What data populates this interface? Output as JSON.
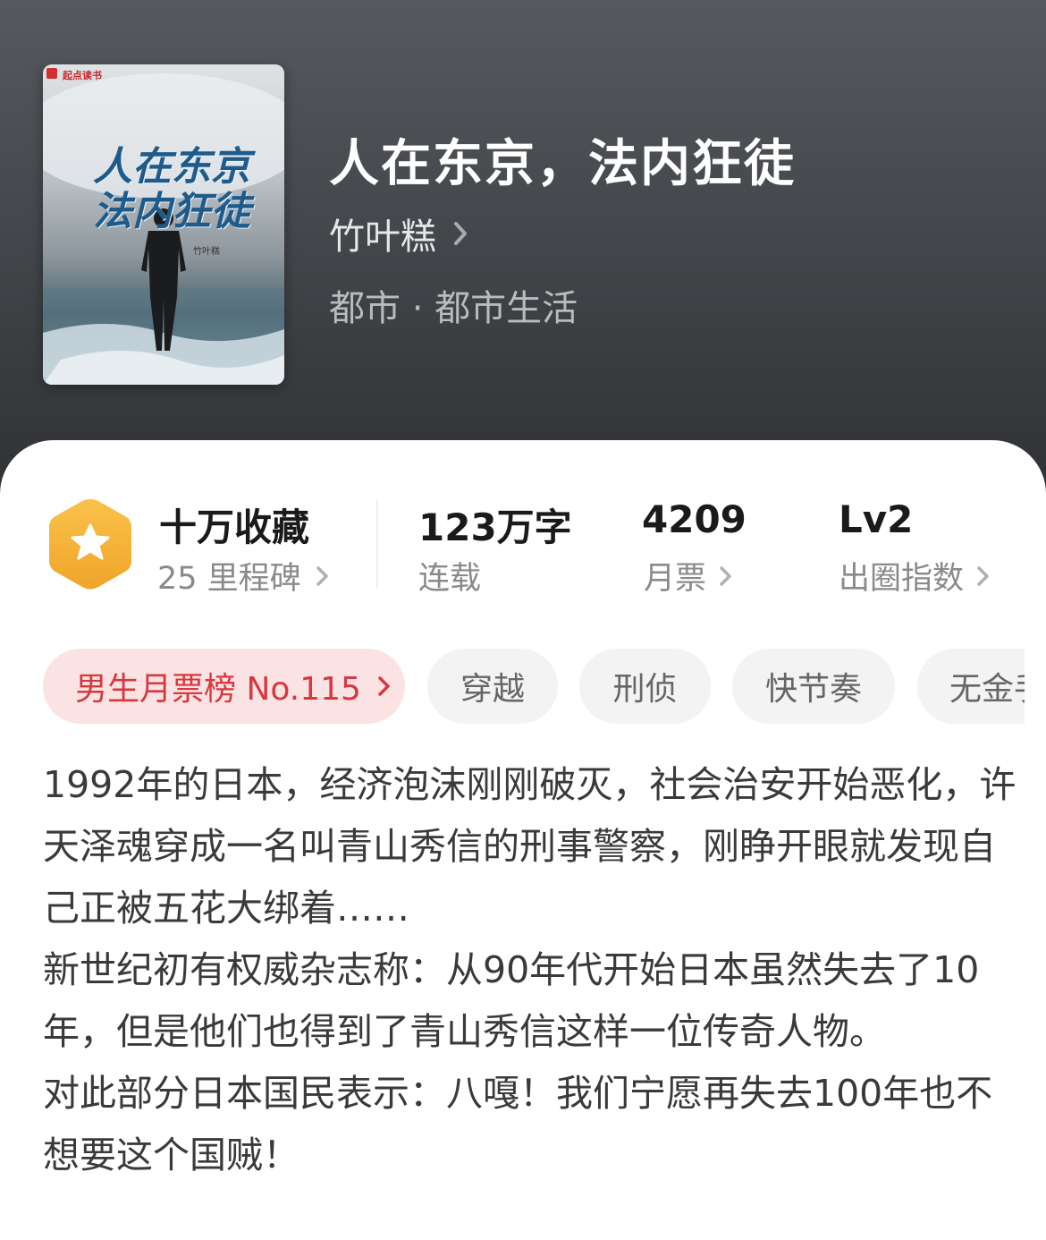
{
  "book": {
    "title": "人在东京，法内狂徒",
    "author": "竹叶糕",
    "category": "都市 · 都市生活",
    "cover": {
      "publisher": "起点读书",
      "title_line1": "人在东京",
      "title_line2": "法内狂徒",
      "author": "竹叶糕"
    }
  },
  "stats": {
    "collection": {
      "main": "十万收藏",
      "sub": "25 里程碑"
    },
    "words": {
      "main": "123万字",
      "sub": "连载"
    },
    "monthly_ticket": {
      "main": "4209",
      "sub": "月票"
    },
    "popularity": {
      "main": "Lv2",
      "sub": "出圈指数"
    }
  },
  "tags": {
    "rank": "男生月票榜 No.115",
    "items": [
      "穿越",
      "刑侦",
      "快节奏",
      "无金手指"
    ]
  },
  "description": {
    "paragraphs": [
      "1992年的日本，经济泡沫刚刚破灭，社会治安开始恶化，许天泽魂穿成一名叫青山秀信的刑事警察，刚睁开眼就发现自己正被五花大绑着……",
      "新世纪初有权威杂志称：从90年代开始日本虽然失去了10年，但是他们也得到了青山秀信这样一位传奇人物。",
      "对此部分日本国民表示：八嘎！我们宁愿再失去100年也不想要这个国贼！"
    ]
  },
  "colors": {
    "header_bg": "#44474b",
    "rank_tag_bg": "#fbe3e3",
    "rank_tag_text": "#d7383f",
    "badge": "#f5b335"
  },
  "icons": {
    "chevron": "chevron-right-icon",
    "badge": "star-hexagon-icon"
  }
}
